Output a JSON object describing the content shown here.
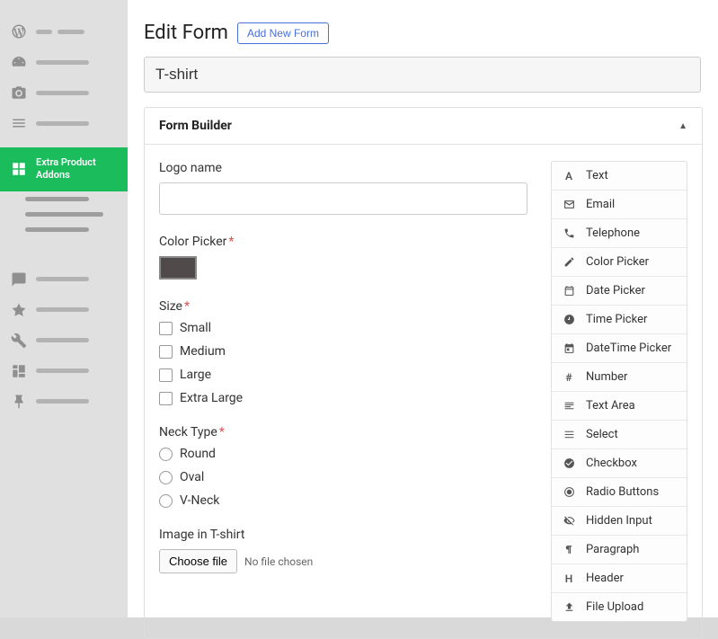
{
  "sidebar": {
    "active_label": "Extra Product Addons"
  },
  "header": {
    "title": "Edit Form",
    "add_new": "Add New Form"
  },
  "form_name": "T-shirt",
  "panel": {
    "title": "Form Builder"
  },
  "fields": {
    "logo": {
      "label": "Logo name"
    },
    "color": {
      "label": "Color Picker",
      "value": "#514a4a"
    },
    "size": {
      "label": "Size",
      "options": [
        "Small",
        "Medium",
        "Large",
        "Extra Large"
      ]
    },
    "neck": {
      "label": "Neck Type",
      "options": [
        "Round",
        "Oval",
        "V-Neck"
      ]
    },
    "image": {
      "label": "Image in T-shirt",
      "button": "Choose file",
      "hint": "No file chosen"
    }
  },
  "palette": [
    {
      "icon": "A",
      "label": "Text"
    },
    {
      "icon": "envelope",
      "label": "Email"
    },
    {
      "icon": "phone",
      "label": "Telephone"
    },
    {
      "icon": "pencil",
      "label": "Color Picker"
    },
    {
      "icon": "calendar",
      "label": "Date Picker"
    },
    {
      "icon": "clock",
      "label": "Time Picker"
    },
    {
      "icon": "calendar2",
      "label": "DateTime Picker"
    },
    {
      "icon": "#",
      "label": "Number"
    },
    {
      "icon": "textarea",
      "label": "Text Area"
    },
    {
      "icon": "list",
      "label": "Select"
    },
    {
      "icon": "check",
      "label": "Checkbox"
    },
    {
      "icon": "radio",
      "label": "Radio Buttons"
    },
    {
      "icon": "eye-off",
      "label": "Hidden Input"
    },
    {
      "icon": "para",
      "label": "Paragraph"
    },
    {
      "icon": "H",
      "label": "Header"
    },
    {
      "icon": "upload",
      "label": "File Upload"
    }
  ]
}
